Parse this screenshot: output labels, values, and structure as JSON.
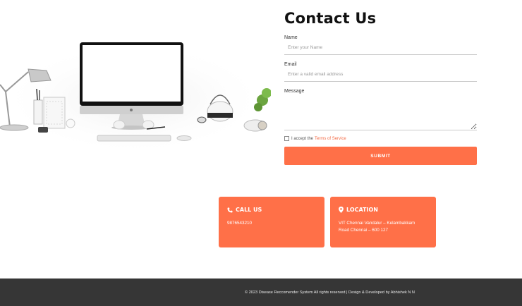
{
  "contact": {
    "title": "Contact Us",
    "name_label": "Name",
    "name_placeholder": "Enter your Name",
    "email_label": "Email",
    "email_placeholder": "Enter a valid email address",
    "message_label": "Message",
    "terms_text": "I accept the",
    "terms_link": "Terms of Service",
    "submit_label": "SUBMIT"
  },
  "cards": {
    "call_title": "CALL US",
    "call_text": "9876543210",
    "location_title": "LOCATION",
    "location_line1": "VIT Chennai Vandalur – Kelambakkam",
    "location_line2": "Road Chennai – 600 127"
  },
  "footer": {
    "text": "© 2023 Disease Reccomender System  All rights reserved | Design & Developed by Abhishek N N"
  },
  "colors": {
    "accent": "#ff7048",
    "footer_bg": "#363636"
  },
  "icons": {
    "call": "phone-icon",
    "location": "map-pin-icon"
  }
}
